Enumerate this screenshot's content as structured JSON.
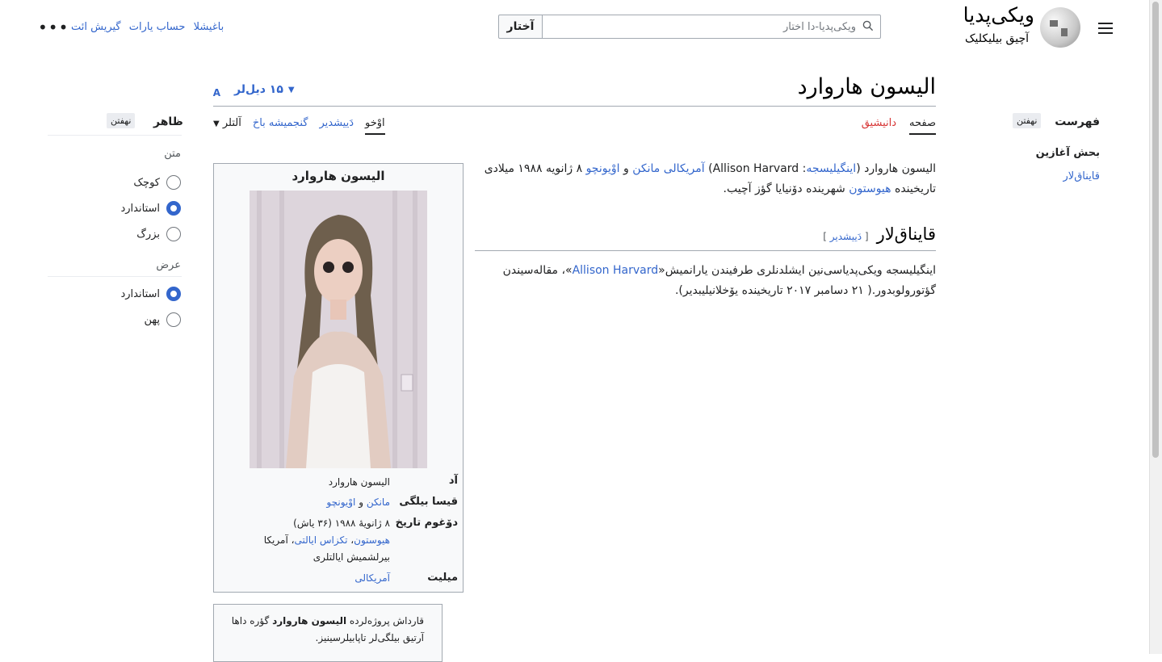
{
  "header": {
    "wordmark": "ویکی‌پدیا",
    "tagline": "آچیق بیلیکلیک",
    "search_button": "آختار",
    "search_placeholder": "ویکی‌پدیا-دا آختار",
    "links": [
      "باغیشلا",
      "حساب یارات",
      "گیریش ائت"
    ]
  },
  "page": {
    "title": "الیسون هاروارد",
    "languages": "۱۵ دیل‌لر",
    "tabs_right": [
      {
        "label": "صفحه",
        "active": true
      },
      {
        "label": "دانیشیق",
        "red": true
      }
    ],
    "tabs_left": [
      {
        "label": "اوْخو",
        "active": true
      },
      {
        "label": "دَییشدیر"
      },
      {
        "label": "گنجمیشه باخ"
      },
      {
        "label": "آلتلر"
      }
    ]
  },
  "appearance": {
    "heading": "ظاهر",
    "hide": "نهفتن",
    "text_label": "متن",
    "text_options": [
      {
        "label": "کوچک",
        "selected": false
      },
      {
        "label": "استاندارد",
        "selected": true
      },
      {
        "label": "بزرگ",
        "selected": false
      }
    ],
    "width_label": "عرض",
    "width_options": [
      {
        "label": "استاندارد",
        "selected": true
      },
      {
        "label": "پهن",
        "selected": false
      }
    ]
  },
  "toc": {
    "heading": "فهرست",
    "hide": "نهفتن",
    "items": [
      "بحش آغازین",
      "قایناق‌لار"
    ]
  },
  "content": {
    "intro_parts": [
      "الیسون هاروارد (",
      "اینگیلیسجه",
      ": Allison Harvard) ",
      "آمریکالی",
      " ",
      "مانکن",
      " و ",
      "اوْیونچو",
      " ۸ ژانویه ۱۹۸۸ میلادی تاریخینده ",
      "هیوستون",
      " شهرینده دۆنیایا گؤز آچیب."
    ],
    "section_heading": "قایناق‌لار",
    "edit_link": "دَییشدیر",
    "ref_parts": [
      "اینگیلیسجه ویکی‌پدیاسی‌نین ایشلدنلری طرفیندن یارانمیش«",
      "Allison Harvard",
      "»، مقاله‌سیندن گؤتورولوبدور.( ۲۱ دسامبر ۲۰۱۷ تاریخینده یۆخلانیلیبدیر)."
    ]
  },
  "infobox": {
    "title": "الیسون هاروارد",
    "rows": [
      {
        "label": "آد",
        "value": "الیسون هاروارد"
      },
      {
        "label": "قیسا بیلگی",
        "value_parts": [
          "مانکن",
          " و ",
          "اوْیونچو"
        ]
      },
      {
        "label": "دۆغوم تاریخ",
        "value_line1": "۸ ژانویهٔ ۱۹۸۸ (۳۶ یاش)",
        "value_links": [
          "هیوستون",
          "تکزاس ایالتی"
        ],
        "value_line2_tail": "، آمریکا",
        "value_line3": "بیرلشمیش ایالتلری"
      },
      {
        "label": "میلیت",
        "value": "آمریکالی"
      }
    ]
  },
  "project_box": {
    "prefix": "قارداش پروژه‌لرده ",
    "bold": "الیسون هاروارد",
    "suffix": " گؤره داها آرتیق بیلگی‌لر تاپابیلرسینیز."
  }
}
